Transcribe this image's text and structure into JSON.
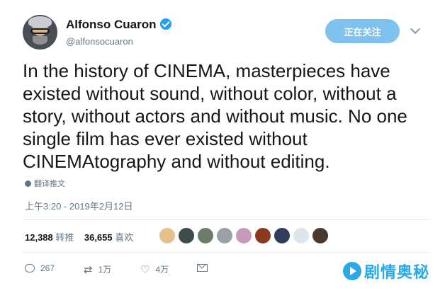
{
  "author": {
    "name": "Alfonso Cuaron",
    "handle": "@alfonsocuaron",
    "verified": true
  },
  "header": {
    "follow_button_label": "正在关注"
  },
  "tweet": {
    "text": "In the history of CINEMA, masterpieces have existed without sound, without color, without a story, without actors and without music. No one single film has ever existed without CINEMAtography and without editing.",
    "translate_label": "翻译推文",
    "timestamp": "上午3:20 - 2019年2月12日"
  },
  "stats": {
    "retweets_count": "12,388",
    "retweets_label": "转推",
    "likes_count": "36,655",
    "likes_label": "喜欢",
    "liker_faces": [
      {
        "color": "#e8c08a"
      },
      {
        "color": "#3d4b4a"
      },
      {
        "color": "#6b7d6a"
      },
      {
        "color": "#9aa0a6"
      },
      {
        "color": "#c79ab8"
      },
      {
        "color": "#8a3a1e"
      },
      {
        "color": "#2e3e5a"
      },
      {
        "color": "#dfe6e9"
      },
      {
        "color": "#4a3a2e"
      }
    ]
  },
  "actions": {
    "reply_count": "267",
    "retweet_count": "1万",
    "like_count": "4万"
  },
  "watermark": {
    "text": "剧情奥秘"
  },
  "colors": {
    "accent": "#1da1f2",
    "follow_button": "#7fc2f0",
    "secondary_text": "#657786",
    "divider": "#e6ecf0",
    "watermark": "#2aa8e8"
  }
}
